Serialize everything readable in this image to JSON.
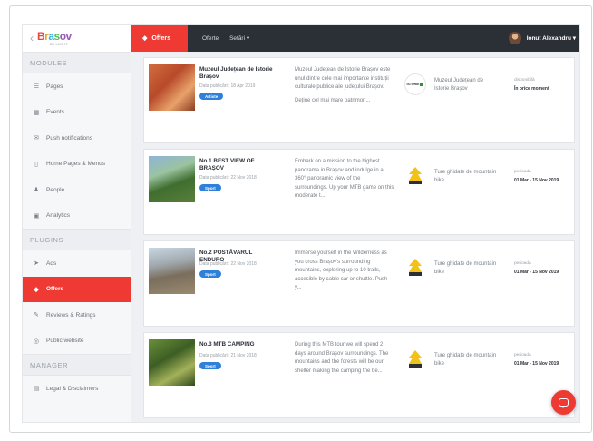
{
  "logo": {
    "parts": [
      "B",
      "r",
      "a",
      "s",
      "ov"
    ],
    "tagline": "BE LIVE IT"
  },
  "sidebar": {
    "sections": [
      {
        "label": "MODULES",
        "items": [
          {
            "icon": "list-icon",
            "glyph": "☰",
            "label": "Pages"
          },
          {
            "icon": "calendar-icon",
            "glyph": "▦",
            "label": "Events"
          },
          {
            "icon": "mail-icon",
            "glyph": "✉",
            "label": "Push notifications"
          },
          {
            "icon": "phone-icon",
            "glyph": "▯",
            "label": "Home Pages & Menus"
          },
          {
            "icon": "person-icon",
            "glyph": "♟",
            "label": "People"
          },
          {
            "icon": "chart-icon",
            "glyph": "▣",
            "label": "Analytics"
          }
        ]
      },
      {
        "label": "PLUGINS",
        "items": [
          {
            "icon": "megaphone-icon",
            "glyph": "➤",
            "label": "Ads"
          },
          {
            "icon": "tag-icon",
            "glyph": "◆",
            "label": "Offers",
            "active": true
          },
          {
            "icon": "chat-icon",
            "glyph": "✎",
            "label": "Reviews & Ratings"
          },
          {
            "icon": "globe-icon",
            "glyph": "◎",
            "label": "Public website"
          }
        ]
      },
      {
        "label": "MANAGER",
        "items": [
          {
            "icon": "doc-icon",
            "glyph": "▤",
            "label": "Legal & Disclaimers"
          }
        ]
      }
    ]
  },
  "topbar": {
    "section": "Offers",
    "tabs": [
      {
        "label": "Oferte",
        "current": true
      },
      {
        "label": "Setări ▾"
      }
    ],
    "user": "Ionut Alexandru ▾"
  },
  "offers": [
    {
      "title": "Muzeul Județean de Istorie Brașov",
      "date": "Data publicării: 18 Apr 2019",
      "badge": "Artiste",
      "desc": "Muzeul Județean de Istorie Brașov este unul dintre cele mai importante instituții culturale publice ale județului Brașov.",
      "desc_more": "Deține cel mai mare patrimon...",
      "org": "Muzeul Județean de Istorie Brașov",
      "org_logo": "muzeu",
      "org_logo_text": "ISTORIE",
      "info_label": "disponibilă",
      "info_value": "În orice moment"
    },
    {
      "title": "No.1 BEST VIEW OF BRAȘOV",
      "date": "Data publicării: 22 Nov 2018",
      "badge": "Sport",
      "desc": "Embark on a mission to the highest panorama in Brașov and indulge in a 360° panoramic view of the surroundings. Up your MTB game on this moderate t...",
      "org": "Ture ghidate de mountain bike",
      "org_logo": "mtb",
      "info_label": "perioada",
      "info_value": "01 Mar - 15 Nov 2019"
    },
    {
      "title": "No.2 POSTĂVARUL ENDURO",
      "date": "Data publicării: 22 Nov 2018",
      "badge": "Sport",
      "desc": "Immerse yourself in the Wilderness as you cross Brașov's surrounding mountains, exploring up to 10 trails, accesible by cable car or shuttle. Push y...",
      "org": "Ture ghidate de mountain bike",
      "org_logo": "mtb",
      "info_label": "perioada",
      "info_value": "01 Mar - 15 Nov 2019"
    },
    {
      "title": "No.3 MTB CAMPING",
      "date": "Data publicării: 21 Nov 2018",
      "badge": "Sport",
      "desc": "During this MTB tour we will spend 2 days around Brașov surroundings. The mountains and the forests will be our shelter making the camping the be...",
      "org": "Ture ghidate de mountain bike",
      "org_logo": "mtb",
      "info_label": "perioada",
      "info_value": "01 Mar - 15 Nov 2019"
    }
  ]
}
